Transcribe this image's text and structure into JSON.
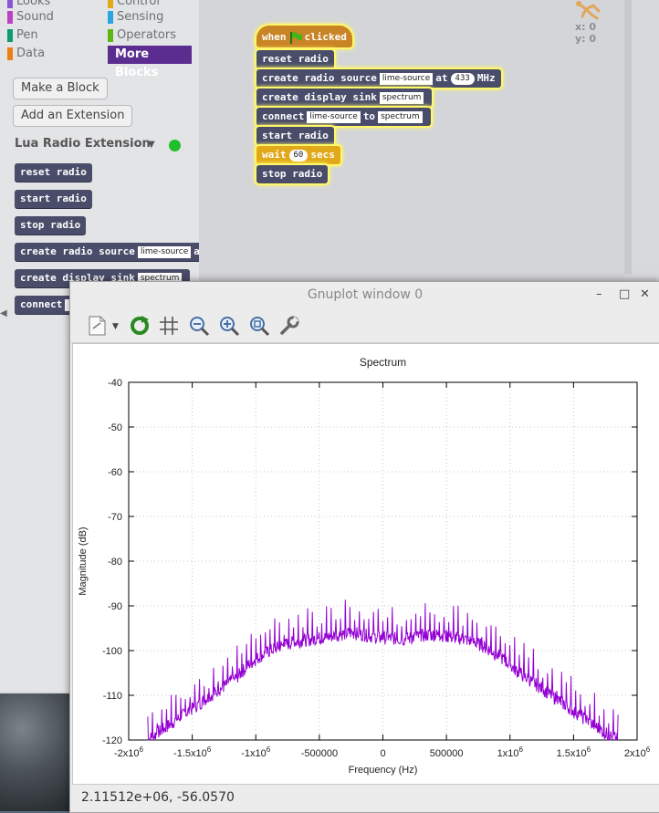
{
  "palette": {
    "categories": [
      {
        "label": "Looks",
        "color": "#8a55d7"
      },
      {
        "label": "Control",
        "color": "#e1a91a"
      },
      {
        "label": "Sound",
        "color": "#bb42c3"
      },
      {
        "label": "Sensing",
        "color": "#2ca5e2"
      },
      {
        "label": "Pen",
        "color": "#0e9a6c"
      },
      {
        "label": "Operators",
        "color": "#5cb712"
      },
      {
        "label": "Data",
        "color": "#ee7d16"
      },
      {
        "label": "More Blocks",
        "color": "#5c2d91"
      }
    ],
    "make_block_label": "Make a Block",
    "add_extension_label": "Add an Extension",
    "extension_title": "Lua Radio Extension",
    "extension_status_color": "#1fbf2c",
    "blocks": {
      "reset": "reset radio",
      "start": "start radio",
      "stop": "stop radio",
      "create_source": "create radio source",
      "source_slot": "lime-source",
      "at": "at",
      "create_sink": "create display sink",
      "sink_slot": "spectrum",
      "connect": "connect"
    }
  },
  "script": {
    "hat_when": "when",
    "hat_clicked": "clicked",
    "reset": "reset radio",
    "create_source": "create radio source",
    "source_slot": "lime-source",
    "at": "at",
    "freq": "433",
    "mhz": "MHz",
    "create_sink": "create display sink",
    "sink_slot": "spectrum",
    "connect": "connect",
    "connect_from": "lime-source",
    "to": "to",
    "connect_to": "spectrum",
    "start": "start radio",
    "wait": "wait",
    "wait_value": "60",
    "secs": "secs",
    "stop": "stop radio"
  },
  "sprite": {
    "x_label": "x: 0",
    "y_label": "y: 0"
  },
  "gnuplot": {
    "window_title": "Gnuplot window 0",
    "status_text": "2.11512e+06, -56.0570",
    "trace_color": "#9400d3"
  },
  "chart_data": {
    "type": "line",
    "title": "Spectrum",
    "xlabel": "Frequency (Hz)",
    "ylabel": "Magnitude (dB)",
    "xlim": [
      -2000000,
      2000000
    ],
    "ylim": [
      -120,
      -40
    ],
    "xticks": [
      {
        "v": -2000000,
        "base": "-2x10",
        "exp": "6"
      },
      {
        "v": -1500000,
        "base": "-1.5x10",
        "exp": "6"
      },
      {
        "v": -1000000,
        "base": "-1x10",
        "exp": "6"
      },
      {
        "v": -500000,
        "base": "-500000",
        "exp": ""
      },
      {
        "v": 0,
        "base": "0",
        "exp": ""
      },
      {
        "v": 500000,
        "base": "500000",
        "exp": ""
      },
      {
        "v": 1000000,
        "base": "1x10",
        "exp": "6"
      },
      {
        "v": 1500000,
        "base": "1.5x10",
        "exp": "6"
      },
      {
        "v": 2000000,
        "base": "2x10",
        "exp": "6"
      }
    ],
    "yticks": [
      -40,
      -50,
      -60,
      -70,
      -80,
      -90,
      -100,
      -110,
      -120
    ],
    "grid": true,
    "series": [
      {
        "x": [
          -1850000,
          -1750000,
          -1650000,
          -1550000,
          -1450000,
          -1350000,
          -1250000,
          -1150000,
          -1050000,
          -950000,
          -850000,
          -750000,
          -650000,
          -550000,
          -450000,
          -350000,
          -250000,
          -150000,
          -50000,
          50000,
          150000,
          250000,
          350000,
          450000,
          550000,
          650000,
          750000,
          850000,
          950000,
          1050000,
          1150000,
          1250000,
          1350000,
          1450000,
          1550000,
          1650000,
          1750000,
          1850000
        ],
        "y": [
          -120,
          -118,
          -116,
          -114,
          -112,
          -110,
          -108,
          -106,
          -103,
          -101,
          -99.5,
          -98.5,
          -97.8,
          -97.5,
          -97,
          -96.5,
          -96,
          -96.5,
          -97,
          -97.2,
          -97.5,
          -97,
          -96.5,
          -96.5,
          -97,
          -97.5,
          -98.5,
          -100,
          -102,
          -104.5,
          -106.5,
          -108.5,
          -110.5,
          -112.5,
          -114.5,
          -116.5,
          -118.5,
          -120
        ]
      }
    ]
  }
}
